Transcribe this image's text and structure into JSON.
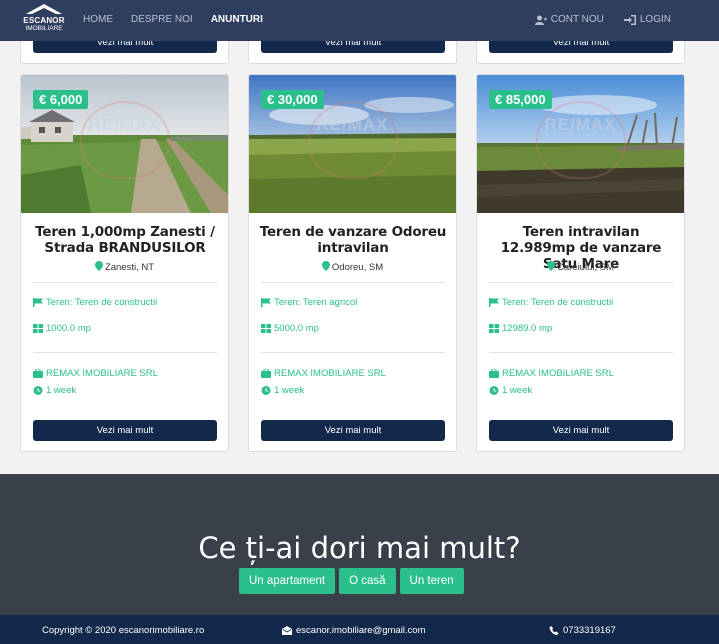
{
  "brand": {
    "line1": "ESCANOR",
    "line2": "IMOBILIARE"
  },
  "nav": {
    "links": [
      "HOME",
      "DESPRE NOI",
      "ANUNTURI"
    ],
    "active": "ANUNTURI",
    "account": "CONT NOU",
    "login": "LOGIN"
  },
  "top_cards": [
    {
      "button": "Vezi mai mult"
    },
    {
      "button": "Vezi mai mult"
    },
    {
      "button": "Vezi mai mult"
    }
  ],
  "listings": [
    {
      "price": "€ 6,000",
      "title": "Teren 1,000mp Zanesti / Strada BRANDUSILOR",
      "location": "Zanesti, NT",
      "type": "Teren: Teren de constructii",
      "area": "1000.0 mp",
      "agency": "REMAX IMOBILIARE SRL",
      "age": "1 week",
      "button": "Vezi mai mult",
      "watermark": "RE/MAX"
    },
    {
      "price": "€ 30,000",
      "title": "Teren de vanzare Odoreu intravilan",
      "location": "Odoreu, SM",
      "type": "Teren: Teren agricol",
      "area": "5000.0 mp",
      "agency": "REMAX IMOBILIARE SRL",
      "age": "1 week",
      "button": "Vezi mai mult",
      "watermark": "RE/MAX"
    },
    {
      "price": "€ 85,000",
      "title": "Teren intravilan 12.989mp de vanzare Satu Mare",
      "location": "Careiului, SM",
      "type": "Teren: Teren de constructii",
      "area": "12989.0 mp",
      "agency": "REMAX IMOBILIARE SRL",
      "age": "1 week",
      "button": "Vezi mai mult",
      "watermark": "RE/MAX"
    }
  ],
  "cta": {
    "title": "Ce ți-ai dori mai mult?",
    "buttons": [
      "Un apartament",
      "O casă",
      "Un teren"
    ]
  },
  "footer": {
    "copyright": "Copyright © 2020 escanorimobiliare.ro",
    "email": "escanor.imobiliare@gmail.com",
    "phone": "0733319167"
  },
  "colors": {
    "navbar": "#2f3e5f",
    "primary": "#13294b",
    "accent": "#2bbf8c",
    "cta_bg": "#3a4049"
  },
  "icons": [
    "user-plus-icon",
    "sign-in-icon",
    "map-marker-icon",
    "flag-icon",
    "area-grid-icon",
    "briefcase-icon",
    "clock-icon",
    "envelope-icon",
    "phone-icon"
  ]
}
